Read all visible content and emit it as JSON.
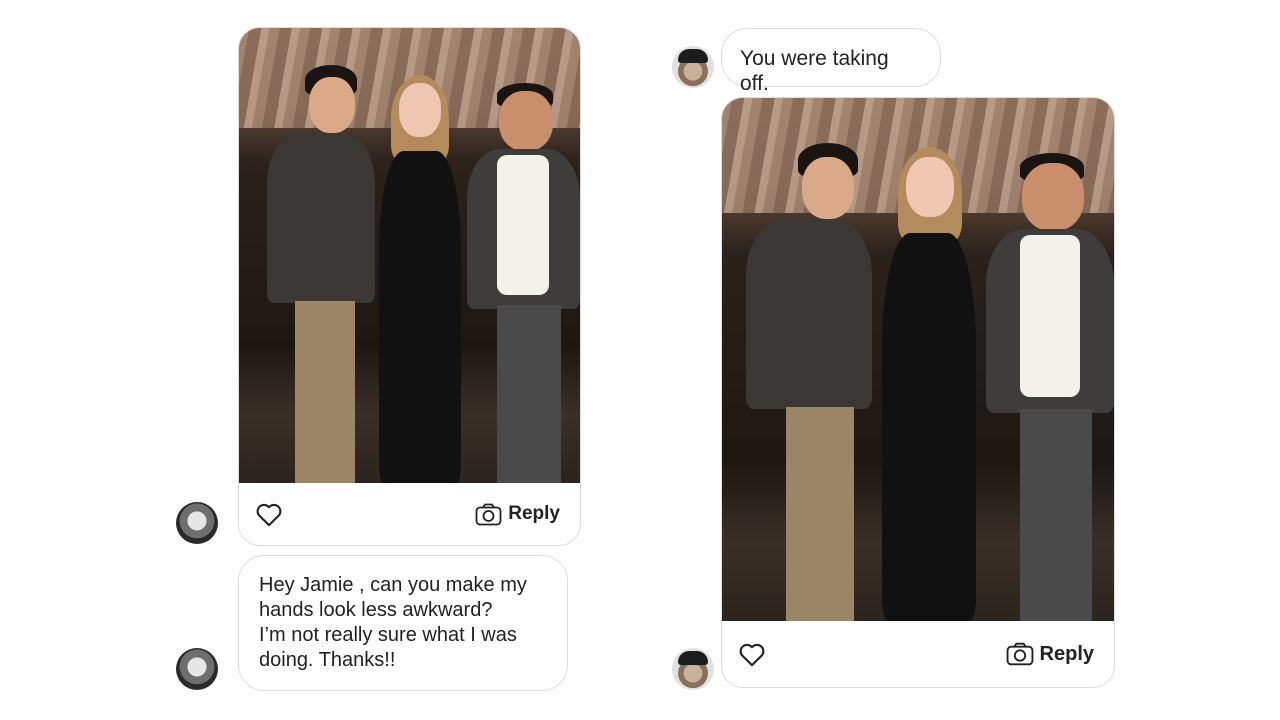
{
  "left_thread": {
    "photo_card": {
      "reply_label": "Reply"
    },
    "message": {
      "lines": [
        "Hey Jamie , can you make my",
        "hands look less awkward?",
        "I’m not really sure what I was",
        "doing. Thanks!!"
      ]
    }
  },
  "right_thread": {
    "message": {
      "text": "You were taking off."
    },
    "photo_card": {
      "reply_label": "Reply"
    }
  },
  "colors": {
    "bubble_border": "#dcdcdc",
    "text": "#222222"
  },
  "icons": [
    "heart-icon",
    "camera-icon"
  ]
}
